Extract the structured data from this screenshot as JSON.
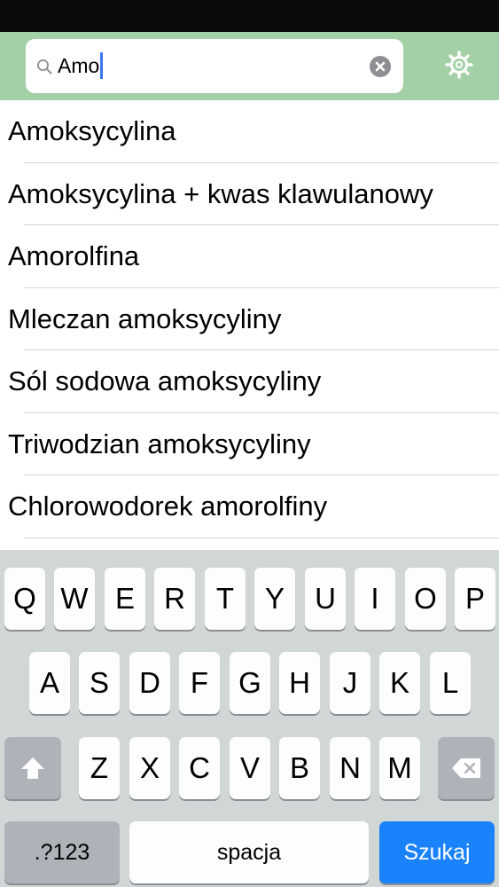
{
  "search": {
    "query": "Amo",
    "icons": {
      "search": "magnifier-icon",
      "clear": "clear-x-icon",
      "settings": "gear-icon"
    }
  },
  "results": [
    "Amoksycylina",
    "Amoksycylina + kwas klawulanowy",
    "Amorolfina",
    "Mleczan amoksycyliny",
    "Sól sodowa amoksycyliny",
    "Triwodzian amoksycyliny",
    "Chlorowodorek amorolfiny"
  ],
  "keyboard": {
    "row1": [
      "Q",
      "W",
      "E",
      "R",
      "T",
      "Y",
      "U",
      "I",
      "O",
      "P"
    ],
    "row2": [
      "A",
      "S",
      "D",
      "F",
      "G",
      "H",
      "J",
      "K",
      "L"
    ],
    "row3": [
      "Z",
      "X",
      "C",
      "V",
      "B",
      "N",
      "M"
    ],
    "numbers_label": ".?123",
    "space_label": "spacja",
    "search_label": "Szukaj",
    "icons": {
      "shift": "shift-arrow-icon",
      "backspace": "backspace-icon"
    },
    "colors": {
      "search_key": "#1a82fb",
      "background": "#d1d6d7"
    }
  },
  "colors": {
    "header": "#a3d0a6",
    "status_bar": "#0b0a0d",
    "cursor": "#3b77f0"
  }
}
